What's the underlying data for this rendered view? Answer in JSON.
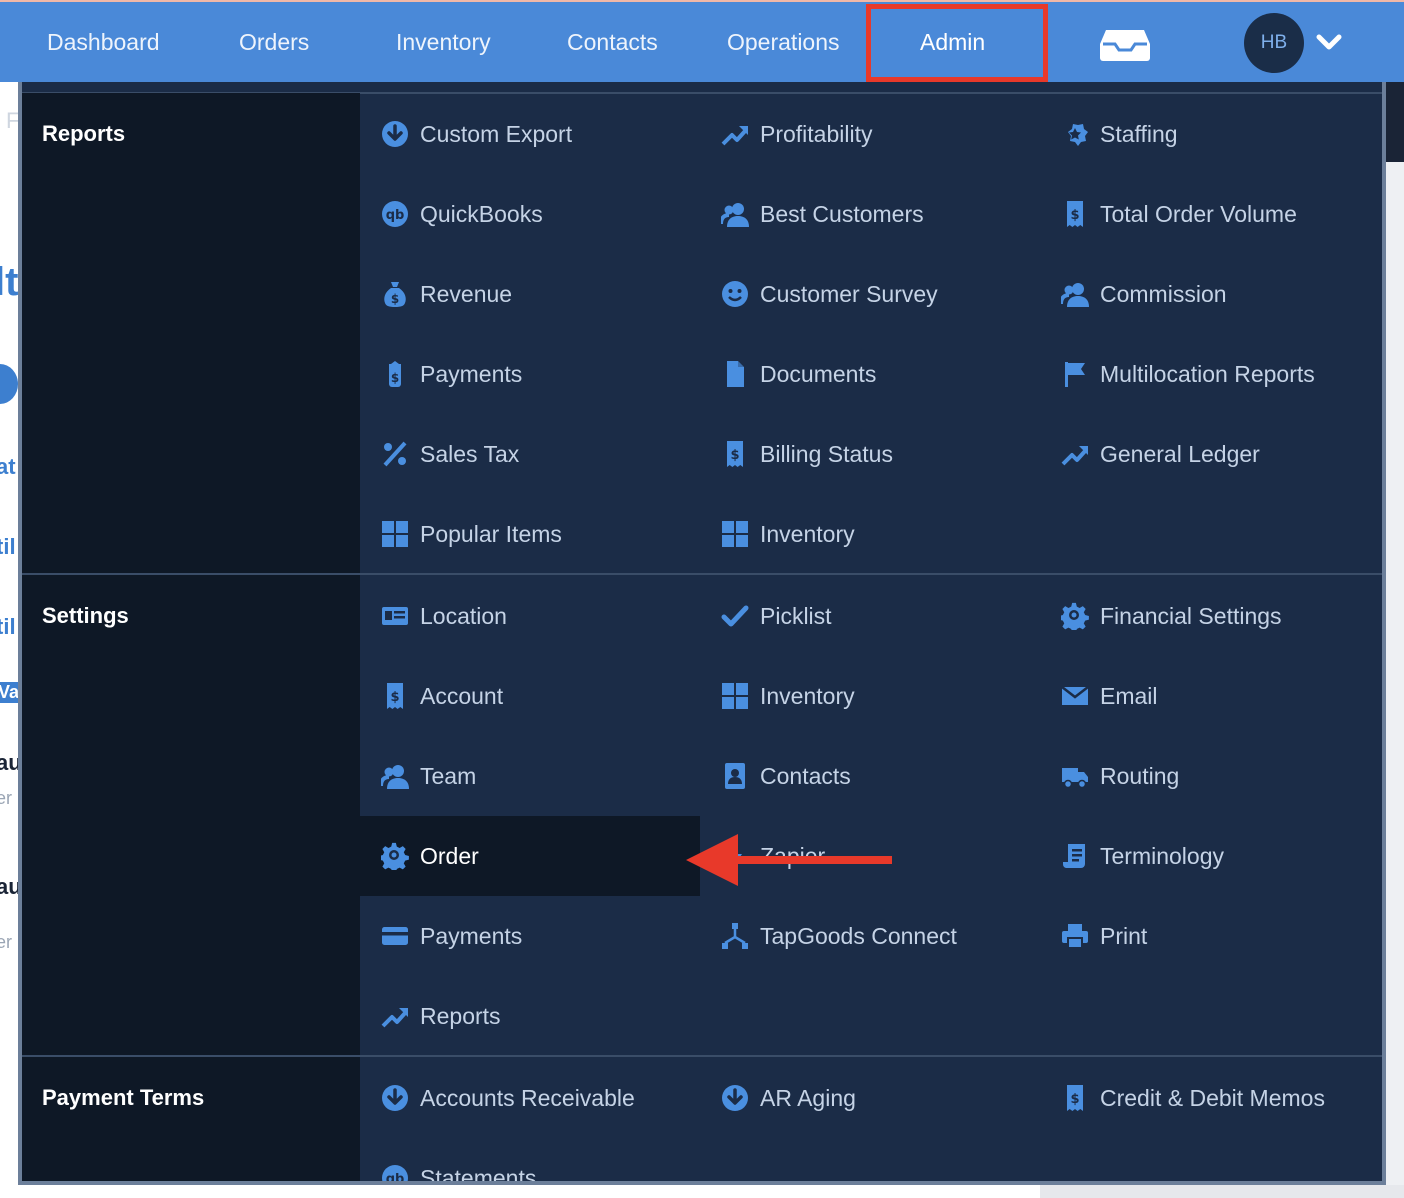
{
  "nav": {
    "items": [
      {
        "label": "Dashboard"
      },
      {
        "label": "Orders"
      },
      {
        "label": "Inventory"
      },
      {
        "label": "Contacts"
      },
      {
        "label": "Operations"
      },
      {
        "label": "Admin"
      }
    ],
    "active": "Admin",
    "avatar_initials": "HB"
  },
  "background_fragments": [
    "F",
    "lt",
    "at",
    "til",
    "til",
    "Vat",
    "au",
    "er",
    "au",
    "er"
  ],
  "menu": {
    "sections": [
      {
        "title": "Reports",
        "items": [
          {
            "label": "Custom Export",
            "icon": "download-circle-icon"
          },
          {
            "label": "Profitability",
            "icon": "trending-up-icon"
          },
          {
            "label": "Staffing",
            "icon": "badge-star-icon"
          },
          {
            "label": "QuickBooks",
            "icon": "quickbooks-icon"
          },
          {
            "label": "Best Customers",
            "icon": "users-icon"
          },
          {
            "label": "Total Order Volume",
            "icon": "receipt-dollar-icon"
          },
          {
            "label": "Revenue",
            "icon": "money-bag-icon"
          },
          {
            "label": "Customer Survey",
            "icon": "smile-icon"
          },
          {
            "label": "Commission",
            "icon": "users-icon"
          },
          {
            "label": "Payments",
            "icon": "price-tag-dollar-icon"
          },
          {
            "label": "Documents",
            "icon": "file-icon"
          },
          {
            "label": "Multilocation Reports",
            "icon": "flag-icon"
          },
          {
            "label": "Sales Tax",
            "icon": "percent-icon"
          },
          {
            "label": "Billing Status",
            "icon": "receipt-dollar-icon"
          },
          {
            "label": "General Ledger",
            "icon": "trending-up-icon"
          },
          {
            "label": "Popular Items",
            "icon": "grid-icon"
          },
          {
            "label": "Inventory",
            "icon": "grid-icon"
          }
        ]
      },
      {
        "title": "Settings",
        "items": [
          {
            "label": "Location",
            "icon": "id-card-icon"
          },
          {
            "label": "Picklist",
            "icon": "check-icon"
          },
          {
            "label": "Financial Settings",
            "icon": "gear-icon"
          },
          {
            "label": "Account",
            "icon": "receipt-dollar-icon"
          },
          {
            "label": "Inventory",
            "icon": "grid-icon"
          },
          {
            "label": "Email",
            "icon": "envelope-icon"
          },
          {
            "label": "Team",
            "icon": "users-icon"
          },
          {
            "label": "Contacts",
            "icon": "contact-book-icon"
          },
          {
            "label": "Routing",
            "icon": "truck-icon"
          },
          {
            "label": "Order",
            "icon": "gear-icon",
            "selected": true
          },
          {
            "label": "Zapier",
            "icon": "zapier-bolt-icon"
          },
          {
            "label": "Terminology",
            "icon": "scroll-icon"
          },
          {
            "label": "Payments",
            "icon": "credit-card-icon"
          },
          {
            "label": "TapGoods Connect",
            "icon": "network-icon"
          },
          {
            "label": "Print",
            "icon": "printer-icon"
          },
          {
            "label": "Reports",
            "icon": "trending-up-icon"
          }
        ]
      },
      {
        "title": "Payment Terms",
        "items": [
          {
            "label": "Accounts Receivable",
            "icon": "download-circle-icon"
          },
          {
            "label": "AR Aging",
            "icon": "download-circle-icon"
          },
          {
            "label": "Credit & Debit Memos",
            "icon": "receipt-dollar-icon"
          },
          {
            "label": "Statements",
            "icon": "quickbooks-icon"
          }
        ]
      }
    ]
  },
  "colors": {
    "nav_bg": "#4a89d8",
    "menu_bg": "#1b2c47",
    "label_col_bg": "#0e1826",
    "icon": "#4a8fe0",
    "highlight_red": "#e8392a"
  }
}
